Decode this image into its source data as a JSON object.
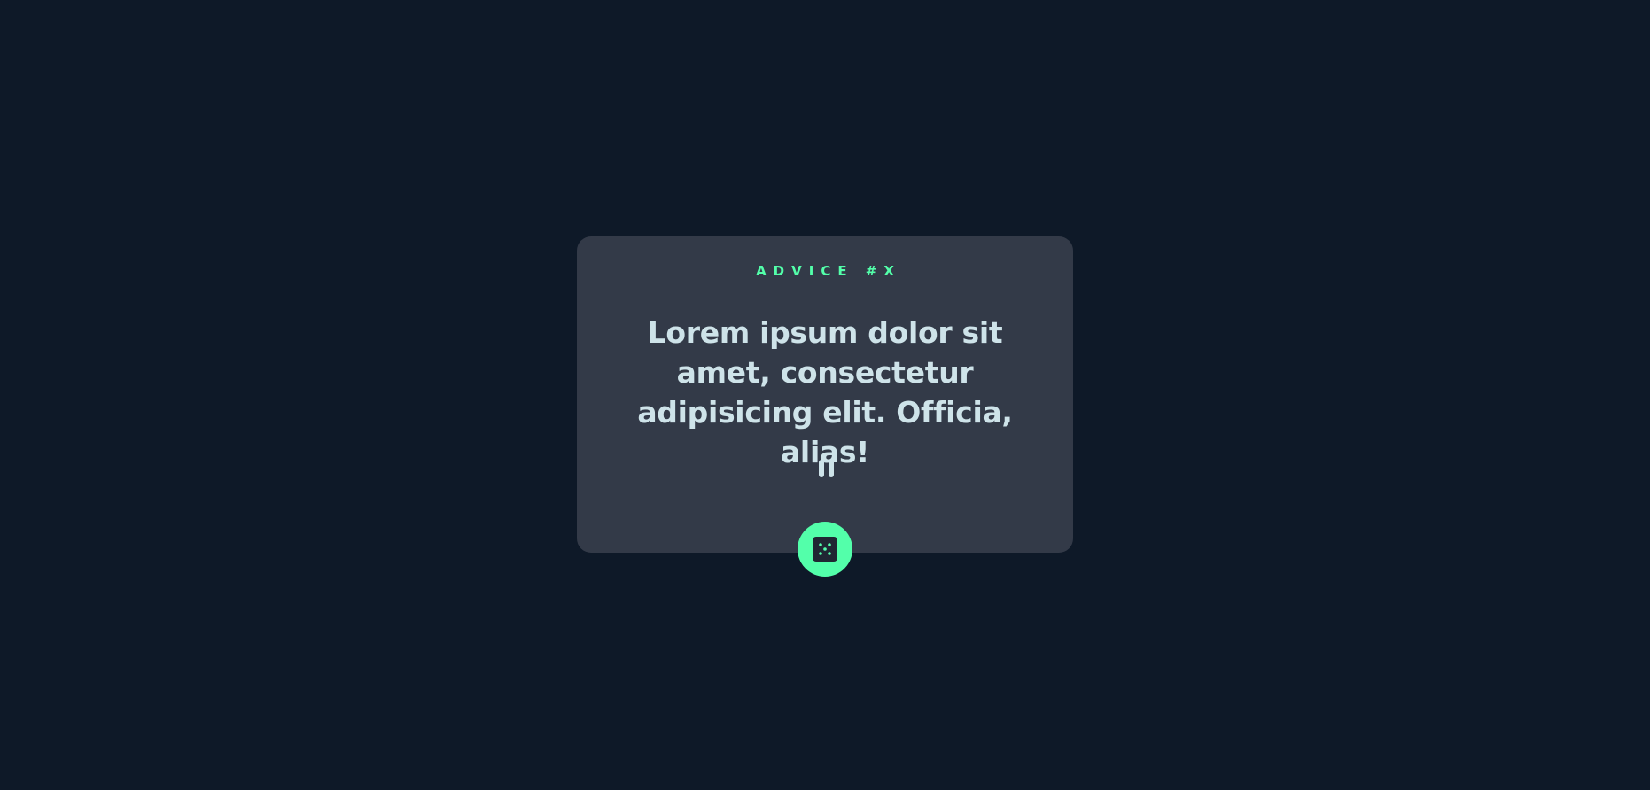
{
  "card": {
    "advice_label": "ADVICE #X",
    "quote": "Lorem ipsum dolor sit amet, consectetur adipisicing elit. Officia, alias!"
  },
  "colors": {
    "background": "#0E1928",
    "card": "#333A48",
    "accent": "#53FFAA",
    "text": "#CEE3E9",
    "divider": "#4F5D74"
  },
  "icons": {
    "divider_icon": "pause-icon",
    "button_icon": "dice-icon"
  }
}
